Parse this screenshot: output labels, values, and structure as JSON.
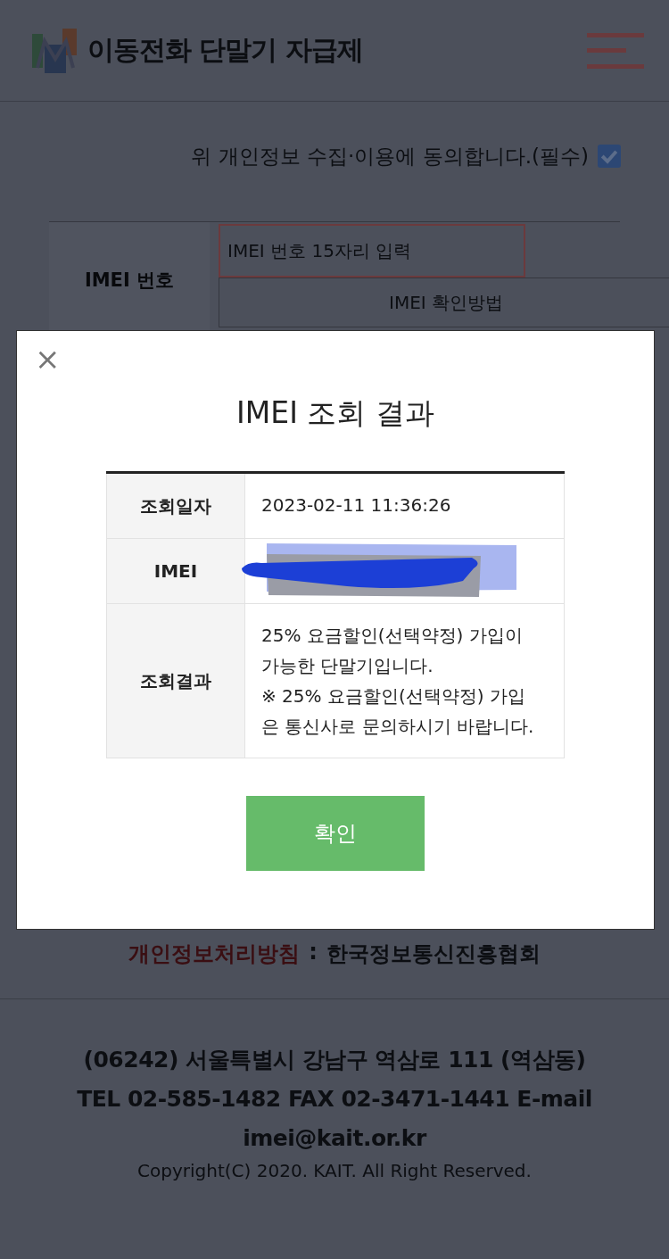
{
  "header": {
    "title": "이동전화 단말기 자급제"
  },
  "consent": {
    "label": "위 개인정보 수집·이용에 동의합니다.(필수)",
    "checked": true
  },
  "imei_form": {
    "label": "IMEI 번호",
    "placeholder": "IMEI 번호 15자리 입력",
    "help_button": "IMEI 확인방법"
  },
  "footer": {
    "policy_link": "개인정보처리방침",
    "separator": ":",
    "organization": "한국정보통신진흥협회",
    "address_lines": [
      "(06242) 서울특별시 강남구 역삼로 111 (역삼동)",
      "TEL 02-585-1482 FAX 02-3471-1441 E-mail",
      "imei@kait.or.kr"
    ],
    "copyright": "Copyright(C) 2020. KAIT. All Right Reserved."
  },
  "modal": {
    "close": "×",
    "title": "IMEI 조회 결과",
    "rows": [
      {
        "label": "조회일자",
        "kind": "text",
        "value": "2023-02-11 11:36:26"
      },
      {
        "label": "IMEI",
        "kind": "redacted"
      },
      {
        "label": "조회결과",
        "kind": "text",
        "value": "25% 요금할인(선택약정) 가입이 가능한 단말기입니다.\n※ 25% 요금할인(선택약정) 가입은 통신사로 문의하시기 바랍니다."
      }
    ],
    "confirm_button": "확인"
  }
}
